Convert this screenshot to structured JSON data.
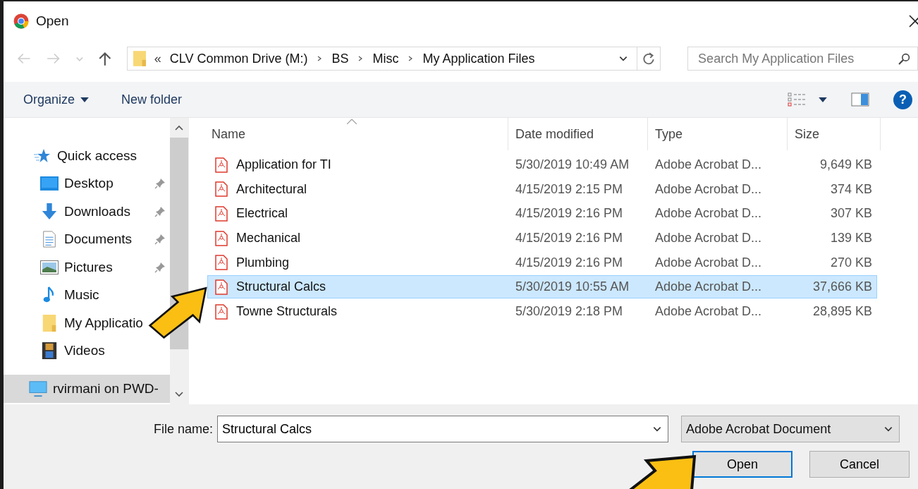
{
  "window": {
    "title": "Open"
  },
  "address": {
    "overflow": "«",
    "crumbs": [
      "CLV Common Drive (M:)",
      "BS",
      "Misc",
      "My Application Files"
    ]
  },
  "search": {
    "placeholder": "Search My Application Files"
  },
  "toolbar": {
    "organize": "Organize",
    "new_folder": "New folder",
    "help": "?"
  },
  "sidebar": {
    "items": [
      {
        "label": "Quick access",
        "kind": "star",
        "pinned": false,
        "selected": false,
        "children": [
          {
            "label": "Desktop",
            "kind": "desktop",
            "pinned": true,
            "selected": false
          },
          {
            "label": "Downloads",
            "kind": "download",
            "pinned": true,
            "selected": false
          },
          {
            "label": "Documents",
            "kind": "document",
            "pinned": true,
            "selected": false
          },
          {
            "label": "Pictures",
            "kind": "picture",
            "pinned": true,
            "selected": false
          },
          {
            "label": "Music",
            "kind": "music",
            "pinned": false,
            "selected": false
          },
          {
            "label": "My Applicatio",
            "kind": "folder",
            "pinned": false,
            "selected": false
          },
          {
            "label": "Videos",
            "kind": "video",
            "pinned": false,
            "selected": false
          }
        ]
      },
      {
        "label": "rvirmani on PWD-",
        "kind": "computer",
        "pinned": false,
        "selected": true
      }
    ]
  },
  "columns": [
    {
      "label": "Name",
      "sorted": true
    },
    {
      "label": "Date modified",
      "sorted": false
    },
    {
      "label": "Type",
      "sorted": false
    },
    {
      "label": "Size",
      "sorted": false
    }
  ],
  "rows": [
    {
      "name": "Application for TI",
      "date": "5/30/2019 10:49 AM",
      "type": "Adobe Acrobat D...",
      "size": "9,649 KB",
      "selected": false
    },
    {
      "name": "Architectural",
      "date": "4/15/2019 2:15 PM",
      "type": "Adobe Acrobat D...",
      "size": "374 KB",
      "selected": false
    },
    {
      "name": "Electrical",
      "date": "4/15/2019 2:16 PM",
      "type": "Adobe Acrobat D...",
      "size": "307 KB",
      "selected": false
    },
    {
      "name": "Mechanical",
      "date": "4/15/2019 2:16 PM",
      "type": "Adobe Acrobat D...",
      "size": "139 KB",
      "selected": false
    },
    {
      "name": "Plumbing",
      "date": "4/15/2019 2:16 PM",
      "type": "Adobe Acrobat D...",
      "size": "270 KB",
      "selected": false
    },
    {
      "name": "Structural Calcs",
      "date": "5/30/2019 10:55 AM",
      "type": "Adobe Acrobat D...",
      "size": "37,666 KB",
      "selected": true
    },
    {
      "name": "Towne Structurals",
      "date": "5/30/2019 2:18 PM",
      "type": "Adobe Acrobat D...",
      "size": "28,895 KB",
      "selected": false
    }
  ],
  "filename": {
    "label": "File name:",
    "value": "Structural Calcs"
  },
  "filetype": {
    "value": "Adobe Acrobat Document"
  },
  "buttons": [
    {
      "label": "Open",
      "default": true
    },
    {
      "label": "Cancel",
      "default": false
    }
  ]
}
